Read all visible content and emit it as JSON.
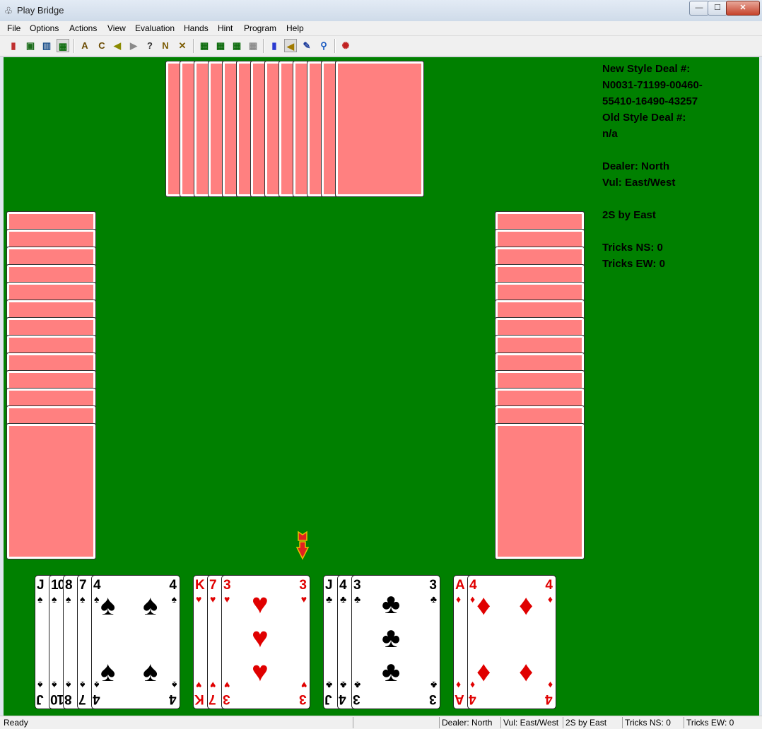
{
  "window": {
    "title": "Play Bridge",
    "app_icon": "bridge-app-icon",
    "minimize_glyph": "—",
    "maximize_glyph": "☐",
    "close_glyph": "✕"
  },
  "menu": {
    "file": "File",
    "options": "Options",
    "actions": "Actions",
    "view": "View",
    "evaluation": "Evaluation",
    "hands": "Hands",
    "hint": "Hint",
    "program": "Program",
    "help": "Help"
  },
  "toolbar": [
    {
      "icon": "new-deal-icon",
      "glyph": "▮",
      "color": "#c03030"
    },
    {
      "icon": "dice-icon",
      "glyph": "▣",
      "color": "#1a6b1a"
    },
    {
      "icon": "deal-number-icon",
      "glyph": "▥",
      "color": "#1a4f8a"
    },
    {
      "icon": "cards-icon",
      "glyph": "▦",
      "color": "#0a6a0a"
    },
    {
      "icon": "auto-play-icon",
      "glyph": "A",
      "color": "#6a4a00"
    },
    {
      "icon": "claim-icon",
      "glyph": "C",
      "color": "#6a4a00"
    },
    {
      "icon": "back-icon",
      "glyph": "◀",
      "color": "#8a8a00"
    },
    {
      "icon": "forward-icon",
      "glyph": "▶",
      "color": "#8a8a8a"
    },
    {
      "icon": "hint-icon",
      "glyph": "?",
      "color": "#333333"
    },
    {
      "icon": "notrump-icon",
      "glyph": "N",
      "color": "#7a5a00"
    },
    {
      "icon": "tools-icon",
      "glyph": "✕",
      "color": "#7a5a00"
    },
    {
      "icon": "layout-1-icon",
      "glyph": "▦",
      "color": "#0a6a0a"
    },
    {
      "icon": "layout-2-icon",
      "glyph": "▦",
      "color": "#0a6a0a"
    },
    {
      "icon": "layout-3-icon",
      "glyph": "▦",
      "color": "#0a6a0a"
    },
    {
      "icon": "layout-4-icon",
      "glyph": "▦",
      "color": "#8a8a8a"
    },
    {
      "icon": "statistics-icon",
      "glyph": "▮",
      "color": "#2a3ad0"
    },
    {
      "icon": "sound-icon",
      "glyph": "◀",
      "color": "#a07a00"
    },
    {
      "icon": "edit-icon",
      "glyph": "✎",
      "color": "#1a3a9a"
    },
    {
      "icon": "zoom-icon",
      "glyph": "⚲",
      "color": "#1a5ac0"
    },
    {
      "icon": "settings-icon",
      "glyph": "✺",
      "color": "#c02020"
    }
  ],
  "info_panel": {
    "lines": [
      "New Style Deal #:",
      "N0031-71199-00460-",
      "55410-16490-43257",
      "Old Style Deal #:",
      "n/a",
      "",
      "Dealer: North",
      "Vul: East/West",
      "",
      "2S by East",
      "",
      "Tricks NS: 0",
      "Tricks EW: 0"
    ]
  },
  "colors": {
    "table": "#008000",
    "card_back": "#ff8080",
    "red_suit": "#e00000",
    "black_suit": "#000000"
  },
  "hands": {
    "north_cards": 13,
    "west_cards": 13,
    "east_cards": 13,
    "south": [
      {
        "suit": "spades",
        "symbol": "♠",
        "color": "black",
        "ranks": [
          "J",
          "10",
          "8",
          "7",
          "4"
        ]
      },
      {
        "suit": "hearts",
        "symbol": "♥",
        "color": "red",
        "ranks": [
          "K",
          "7",
          "3"
        ]
      },
      {
        "suit": "clubs",
        "symbol": "♣",
        "color": "black",
        "ranks": [
          "J",
          "4",
          "3"
        ]
      },
      {
        "suit": "diamonds",
        "symbol": "♦",
        "color": "red",
        "ranks": [
          "A",
          "4"
        ]
      }
    ]
  },
  "turn_indicator": "turn-arrow-icon",
  "statusbar": {
    "ready": "Ready",
    "dealer": "Dealer: North",
    "vul": "Vul: East/West",
    "contract": "2S by East",
    "tricks_ns": "Tricks NS: 0",
    "tricks_ew": "Tricks EW: 0"
  }
}
